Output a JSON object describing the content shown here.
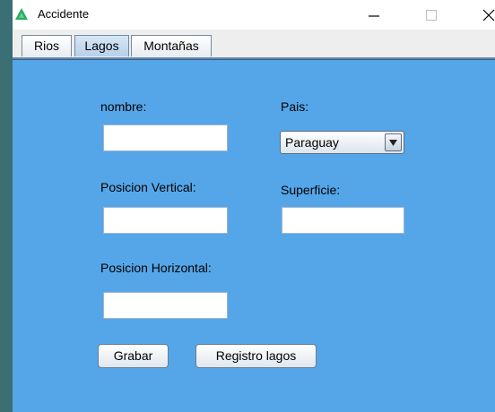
{
  "window": {
    "title": "Accidente",
    "icon": "green-triangle-icon",
    "accent": "#27ae60"
  },
  "tabs": [
    {
      "label": "Rios",
      "active": false
    },
    {
      "label": "Lagos",
      "active": true
    },
    {
      "label": "Montañas",
      "active": false
    }
  ],
  "form": {
    "nombre_label": "nombre:",
    "nombre_value": "",
    "pais_label": "Pais:",
    "pais_selected": "Paraguay",
    "posicion_vertical_label": "Posicion Vertical:",
    "posicion_vertical_value": "",
    "superficie_label": "Superficie:",
    "superficie_value": "",
    "posicion_horizontal_label": "Posicion Horizontal:",
    "posicion_horizontal_value": ""
  },
  "buttons": {
    "grabar": "Grabar",
    "registro_lagos": "Registro lagos"
  },
  "colors": {
    "panel_bg": "#55a6e8",
    "desktop_bg": "#3a6f73"
  }
}
